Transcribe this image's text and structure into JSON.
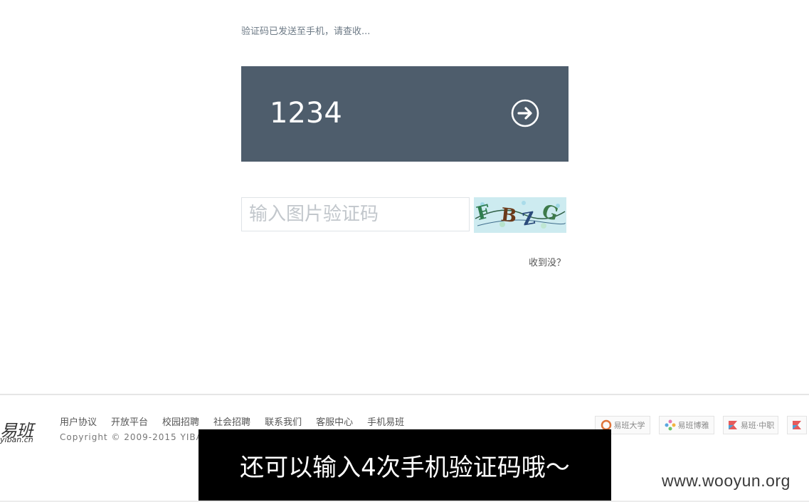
{
  "verification": {
    "sent_notice": "验证码已发送至手机，请查收...",
    "sms_code_value": "1234",
    "submit_icon": "arrow-right-circle-icon",
    "panel_color": "#4e5d6c"
  },
  "captcha": {
    "placeholder": "输入图片验证码",
    "image_text": "FBZG",
    "not_received_link": "收到没？"
  },
  "footer": {
    "logo_main": "易班",
    "logo_sub": "yiban.cn",
    "nav": [
      "用户协议",
      "开放平台",
      "校园招聘",
      "社会招聘",
      "联系我们",
      "客服中心",
      "手机易班"
    ],
    "copyright": "Copyright © 2009-2015 YIBA",
    "partners": [
      "易班大学",
      "易班博雅",
      "易班·中职"
    ]
  },
  "overlay": {
    "caption": "还可以输入4次手机验证码哦～"
  },
  "watermark": "www.wooyun.org"
}
